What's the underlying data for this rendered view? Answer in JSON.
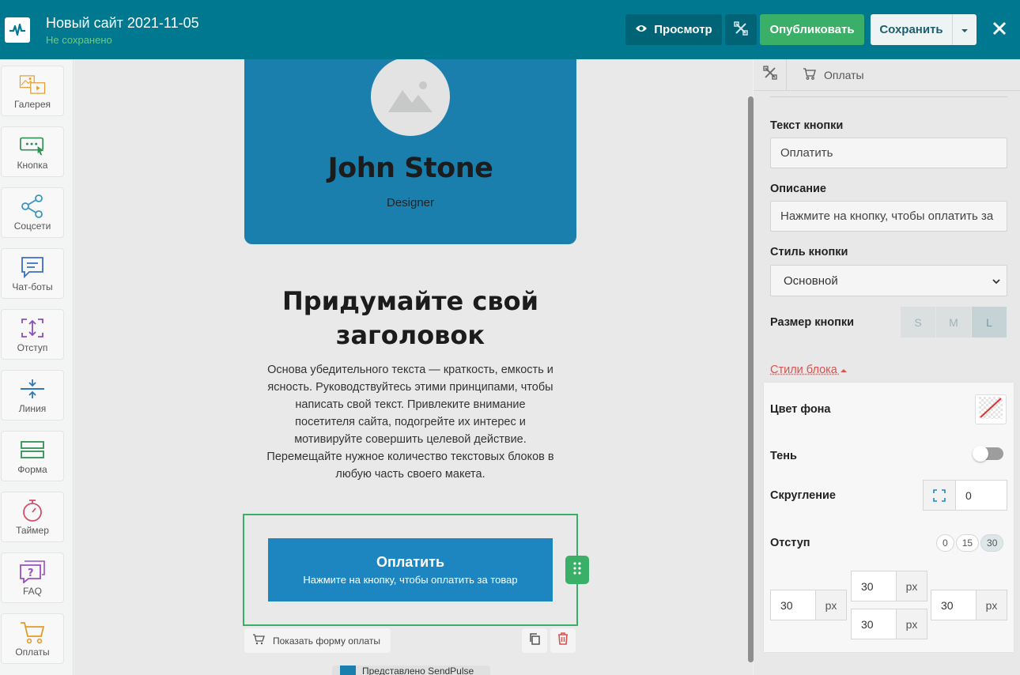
{
  "header": {
    "site_title": "Новый сайт 2021-11-05",
    "site_status": "Не сохранено",
    "preview_label": "Просмотр",
    "publish_label": "Опубликовать",
    "save_label": "Сохранить"
  },
  "sidebar": {
    "items": [
      {
        "label": "Галерея",
        "icon": "gallery-icon"
      },
      {
        "label": "Кнопка",
        "icon": "button-icon"
      },
      {
        "label": "Соцсети",
        "icon": "share-icon"
      },
      {
        "label": "Чат-боты",
        "icon": "chat-icon"
      },
      {
        "label": "Отступ",
        "icon": "spacing-icon"
      },
      {
        "label": "Линия",
        "icon": "line-icon"
      },
      {
        "label": "Форма",
        "icon": "form-icon"
      },
      {
        "label": "Таймер",
        "icon": "timer-icon"
      },
      {
        "label": "FAQ",
        "icon": "faq-icon"
      },
      {
        "label": "Оплаты",
        "icon": "cart-icon"
      }
    ]
  },
  "canvas": {
    "profile": {
      "name": "John Stone",
      "role": "Designer"
    },
    "headline": "Придумайте свой заголовок",
    "body": "Основа убедительного текста — краткость, емкость и ясность. Руководствуйтесь этими принципами, чтобы написать свой текст. Привлеките внимание посетителя сайта, подогрейте их интерес и мотивируйте совершить целевой действие. Перемещайте нужное количество текстовых блоков в любую часть своего макета.",
    "pay_button": {
      "title": "Оплатить",
      "description": "Нажмите на кнопку, чтобы оплатить за товар"
    },
    "show_form_label": "Показать форму оплаты",
    "footer_peek": "Представлено SendPulse"
  },
  "panel": {
    "breadcrumb": "Оплаты",
    "button_text_label": "Текст кнопки",
    "button_text_value": "Оплатить",
    "description_label": "Описание",
    "description_value": "Нажмите на кнопку, чтобы оплатить за",
    "button_style_label": "Стиль кнопки",
    "button_style_value": "Основной",
    "button_size_label": "Размер кнопки",
    "sizes": [
      "S",
      "M",
      "L"
    ],
    "active_size": "L",
    "block_styles_label": "Стили блока",
    "bg_color_label": "Цвет фона",
    "shadow_label": "Тень",
    "shadow_on": false,
    "radius_label": "Скругление",
    "radius_value": "0",
    "padding_label": "Отступ",
    "padding_options": [
      "0",
      "15",
      "30"
    ],
    "active_padding": "30",
    "padding": {
      "top": "30",
      "bottom": "30",
      "left": "30",
      "right": "30",
      "unit": "px"
    }
  },
  "colors": {
    "header": "#00788f",
    "publish": "#3aaf68",
    "accent_blue": "#1d86c0",
    "link_red": "#d9534f"
  }
}
